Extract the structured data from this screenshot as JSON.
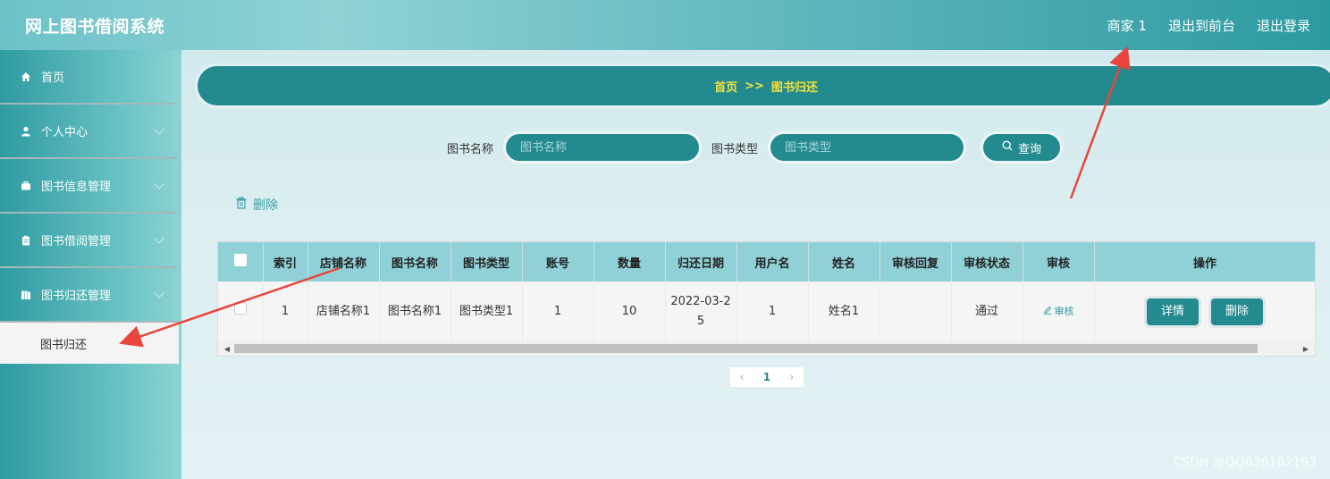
{
  "header": {
    "title": "网上图书借阅系统",
    "user": "商家 1",
    "exit_front": "退出到前台",
    "logout": "退出登录"
  },
  "sidebar": {
    "items": [
      {
        "label": "首页",
        "icon": "home-icon"
      },
      {
        "label": "个人中心",
        "icon": "user-icon"
      },
      {
        "label": "图书信息管理",
        "icon": "briefcase-icon"
      },
      {
        "label": "图书借阅管理",
        "icon": "clipboard-icon"
      },
      {
        "label": "图书归还管理",
        "icon": "book-icon"
      }
    ],
    "subitem": "图书归还"
  },
  "breadcrumb": {
    "home": "首页",
    "sep": ">>",
    "current": "图书归还"
  },
  "search": {
    "name_label": "图书名称",
    "name_placeholder": "图书名称",
    "type_label": "图书类型",
    "type_placeholder": "图书类型",
    "query": "查询"
  },
  "toolbar": {
    "delete": "删除"
  },
  "table": {
    "headers": [
      "索引",
      "店铺名称",
      "图书名称",
      "图书类型",
      "账号",
      "数量",
      "归还日期",
      "用户名",
      "姓名",
      "审核回复",
      "审核状态",
      "审核",
      "操作"
    ],
    "row": {
      "index": "1",
      "shop": "店铺名称1",
      "book": "图书名称1",
      "type": "图书类型1",
      "account": "1",
      "qty": "10",
      "date": "2022-03-25",
      "username": "1",
      "name": "姓名1",
      "reply": "",
      "status": "通过",
      "audit": "审核",
      "detail_btn": "详情",
      "delete_btn": "删除"
    }
  },
  "pager": {
    "current": "1"
  },
  "watermark": "CSDN @QQ626162193",
  "colors": {
    "accent": "#238b8f",
    "breadcrumb_text": "#f5e13a",
    "annotation": "#e8453c"
  }
}
